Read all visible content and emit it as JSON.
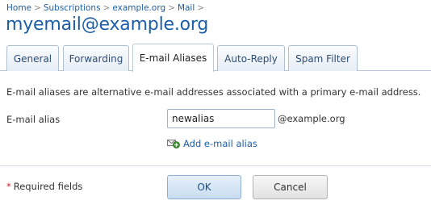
{
  "breadcrumb": {
    "items": [
      "Home",
      "Subscriptions",
      "example.org",
      "Mail"
    ],
    "separator": ">"
  },
  "page_title": "myemail@example.org",
  "tabs": [
    {
      "label": "General",
      "active": false
    },
    {
      "label": "Forwarding",
      "active": false
    },
    {
      "label": "E-mail Aliases",
      "active": true
    },
    {
      "label": "Auto-Reply",
      "active": false
    },
    {
      "label": "Spam Filter",
      "active": false
    }
  ],
  "description": "E-mail aliases are alternative e-mail addresses associated with a primary e-mail address.",
  "form": {
    "alias_label": "E-mail alias",
    "alias_value": "newalias",
    "domain_suffix": "@example.org",
    "add_link_label": "Add e-mail alias",
    "add_icon": "add-envelope-icon"
  },
  "footer": {
    "required_star": "*",
    "required_text": "Required fields",
    "ok_label": "OK",
    "cancel_label": "Cancel"
  },
  "colors": {
    "link": "#1c5ea8",
    "title": "#1c5ea8",
    "required_star": "#c62828",
    "add_icon_green": "#3c9a2e"
  }
}
